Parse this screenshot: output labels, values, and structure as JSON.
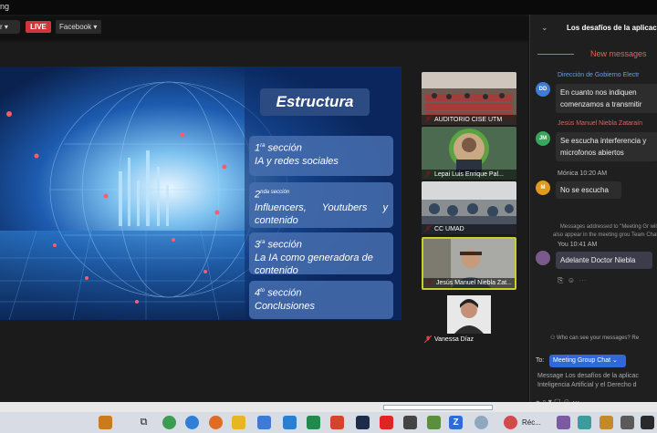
{
  "window": {
    "title_fragment": "ng"
  },
  "toolbar": {
    "left_fragment": "r",
    "live_label": "LIVE",
    "platform_select": "Facebook"
  },
  "slide": {
    "title": "Estructura",
    "sections": [
      {
        "num": "1",
        "sup": "ra",
        "suffix": " sección",
        "text": "IA y redes sociales"
      },
      {
        "num": "2",
        "sup": "nda sección",
        "suffix": "",
        "text": "Influencers, Youtubers y contenido"
      },
      {
        "num": "3",
        "sup": "ra",
        "suffix": " sección",
        "text": "La IA como generadora de contenido"
      },
      {
        "num": "4",
        "sup": "to",
        "suffix": " sección",
        "text": "Conclusiones"
      }
    ]
  },
  "participants": [
    {
      "name": "AUDITORIO CISE UTM"
    },
    {
      "name": "Lepai Luis Enrique Pal..."
    },
    {
      "name": "CC UMAD"
    },
    {
      "name": "Jesús Manuel Niebla Zat..."
    },
    {
      "name": "Vanessa Díaz"
    }
  ],
  "chat": {
    "title": "Los desafíos de la aplicaci",
    "new_messages": "New messages",
    "messages": [
      {
        "initials": "DD",
        "color": "#3e7bd6",
        "sender": "Dirección de Gobierno Electr",
        "lines": [
          "En cuanto nos indiquen",
          "comenzamos a transmitir"
        ]
      },
      {
        "initials": "JM",
        "color": "#39a55b",
        "sender": "Jesús Manuel Niebla Zataraín",
        "lines": [
          "Se escucha interferencia y",
          "microfonos abiertos"
        ]
      },
      {
        "initials": "M",
        "color": "#e09a20",
        "sender": "Mónica 10:20 AM",
        "lines": [
          "No se escucha"
        ]
      }
    ],
    "notice": "Messages addressed to \"Meeting Gr will also appear in the meeting grou Team Chat",
    "own_message": {
      "meta": "You 10:41 AM",
      "text": "Adelante Doctor Niebla"
    },
    "who_can_see": "Who can see your messages? Re",
    "to_label": "To:",
    "recipient": "Meeting Group Chat",
    "input_line1": "Message Los desafíos de la aplicac",
    "input_line2": "Inteligencia Artificial y el Derecho d"
  },
  "taskbar": {
    "active_label": "Réc..."
  }
}
